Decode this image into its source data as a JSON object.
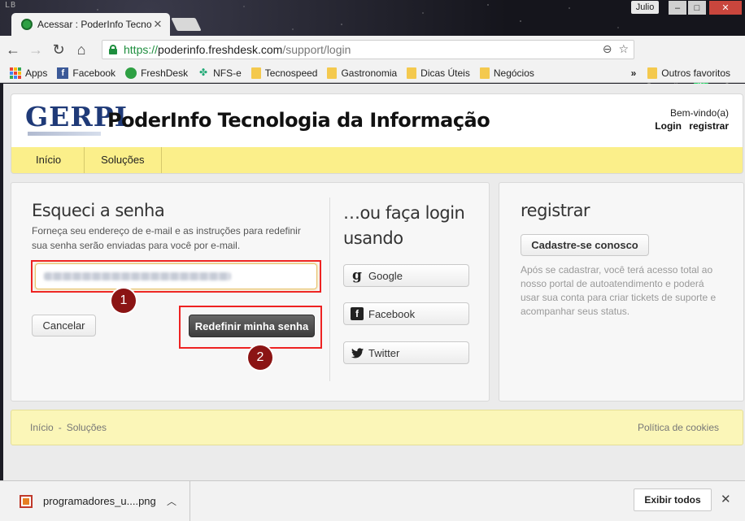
{
  "browser": {
    "logo_text": "LB",
    "tab_title": "Acessar : PoderInfo Tecnol",
    "tab_close": "✕",
    "user_label": "Julio",
    "win_minimize": "–",
    "win_maximize": "□",
    "win_close": "✕",
    "url_https": "https://",
    "url_host": "poderinfo.freshdesk.com",
    "url_path": "/support/login",
    "bookmarks": [
      {
        "label": "Apps",
        "icon": "apps-icon"
      },
      {
        "label": "Facebook",
        "icon": "facebook-icon"
      },
      {
        "label": "FreshDesk",
        "icon": "freshdesk-icon"
      },
      {
        "label": "NFS-e",
        "icon": "nfse-icon"
      },
      {
        "label": "Tecnospeed",
        "icon": "folder-icon"
      },
      {
        "label": "Gastronomia",
        "icon": "folder-icon"
      },
      {
        "label": "Dicas Úteis",
        "icon": "folder-icon"
      },
      {
        "label": "Negócios",
        "icon": "folder-icon"
      }
    ],
    "bookmarks_more": "»",
    "other_bookmarks": "Outros favoritos"
  },
  "header": {
    "logo": "GERPI",
    "company": "PoderInfo Tecnologia da Informação",
    "welcome": "Bem-vindo(a)",
    "login": "Login",
    "register": "registrar"
  },
  "nav": {
    "home": "Início",
    "solutions": "Soluções"
  },
  "forgot": {
    "title": "Esqueci a senha",
    "description": "Forneça seu endereço de e-mail e as instruções para redefinir sua senha serão enviadas para você por e-mail.",
    "cancel": "Cancelar",
    "reset": "Redefinir minha senha",
    "badge1": "1",
    "badge2": "2"
  },
  "social": {
    "title": "…ou faça login usando",
    "google": "Google",
    "facebook": "Facebook",
    "twitter": "Twitter"
  },
  "register": {
    "title": "registrar",
    "button": "Cadastre-se conosco",
    "text": "Após se cadastrar, você terá acesso total ao nosso portal de autoatendimento e poderá usar sua conta para criar tickets de suporte e acompanhar seus status."
  },
  "footer": {
    "home": "Início",
    "separator": "-",
    "solutions": "Soluções",
    "cookies": "Política de cookies"
  },
  "downloads": {
    "file_name": "programadores_u....png",
    "show_all": "Exibir todos",
    "close": "✕"
  }
}
